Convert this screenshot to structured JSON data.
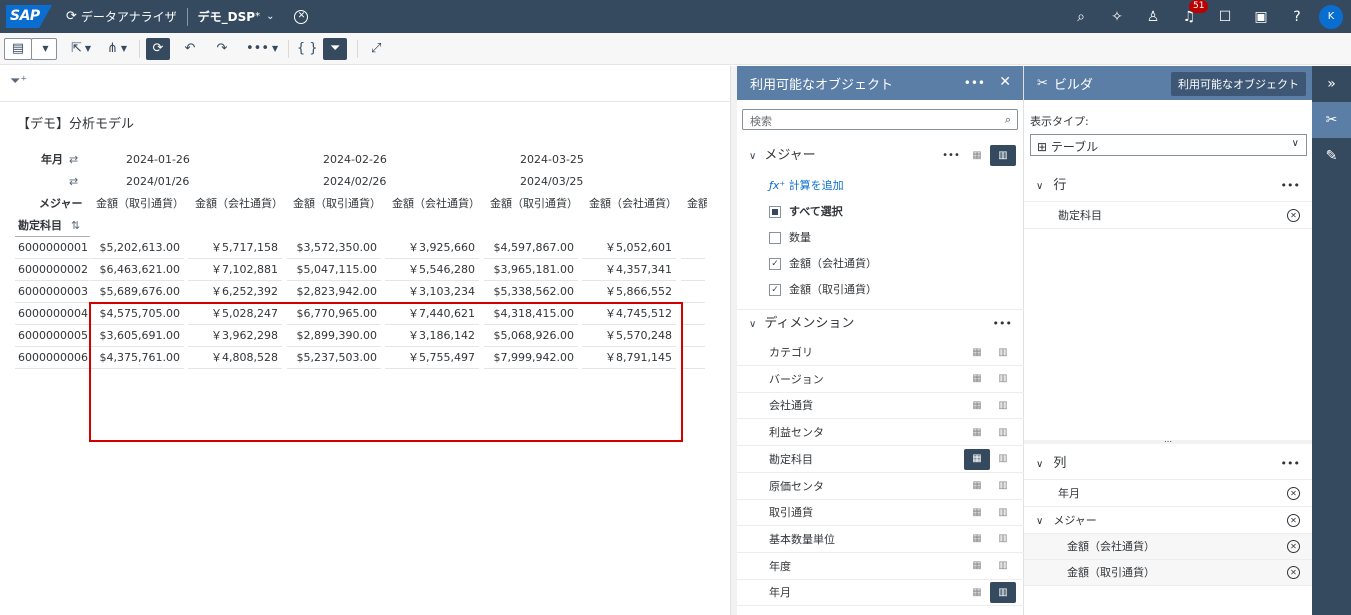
{
  "shell": {
    "logo": "SAP",
    "app_name": "データアナライザ",
    "doc_name": "デモ_DSP",
    "doc_modified": "*",
    "notif_count": "51",
    "avatar_initial": "K"
  },
  "report": {
    "title": "【デモ】分析モデル"
  },
  "grid": {
    "row_label_year": "年月",
    "row_label_measure": "メジャー",
    "row_label_account": "勘定科目",
    "date_headers": [
      "2024-01-26",
      "2024-02-26",
      "2024-03-25"
    ],
    "date_headers_alt": [
      "2024/01/26",
      "2024/02/26",
      "2024/03/25"
    ],
    "measure_headers": [
      "金額（取引通貨）",
      "金額（会社通貨）",
      "金額（取引通貨）",
      "金額（会社通貨）",
      "金額（取引通貨）",
      "金額（会社通貨）",
      "金額"
    ],
    "rows": [
      {
        "account": "6000000001",
        "values": [
          "$5,202,613.00",
          "￥5,717,158",
          "$3,572,350.00",
          "￥3,925,660",
          "$4,597,867.00",
          "￥5,052,601"
        ]
      },
      {
        "account": "6000000002",
        "values": [
          "$6,463,621.00",
          "￥7,102,881",
          "$5,047,115.00",
          "￥5,546,280",
          "$3,965,181.00",
          "￥4,357,341"
        ]
      },
      {
        "account": "6000000003",
        "values": [
          "$5,689,676.00",
          "￥6,252,392",
          "$2,823,942.00",
          "￥3,103,234",
          "$5,338,562.00",
          "￥5,866,552"
        ]
      },
      {
        "account": "6000000004",
        "values": [
          "$4,575,705.00",
          "￥5,028,247",
          "$6,770,965.00",
          "￥7,440,621",
          "$4,318,415.00",
          "￥4,745,512"
        ]
      },
      {
        "account": "6000000005",
        "values": [
          "$3,605,691.00",
          "￥3,962,298",
          "$2,899,390.00",
          "￥3,186,142",
          "$5,068,926.00",
          "￥5,570,248"
        ]
      },
      {
        "account": "6000000006",
        "values": [
          "$4,375,761.00",
          "￥4,808,528",
          "$5,237,503.00",
          "￥5,755,497",
          "$7,999,942.00",
          "￥8,791,145"
        ]
      }
    ]
  },
  "objects": {
    "title": "利用可能なオブジェクト",
    "search_placeholder": "検索",
    "measures_label": "メジャー",
    "add_calc": "計算を追加",
    "measure_items": [
      {
        "label": "すべて選択",
        "state": "partial"
      },
      {
        "label": "数量",
        "state": "off"
      },
      {
        "label": "金額（会社通貨）",
        "state": "on"
      },
      {
        "label": "金額（取引通貨）",
        "state": "on"
      }
    ],
    "dimensions_label": "ディメンション",
    "dimension_items": [
      "カテゴリ",
      "バージョン",
      "会社通貨",
      "利益センタ",
      "勘定科目",
      "原価センタ",
      "取引通貨",
      "基本数量単位",
      "年度",
      "年月"
    ]
  },
  "builder": {
    "title": "ビルダ",
    "objects_button": "利用可能なオブジェクト",
    "display_type_label": "表示タイプ:",
    "display_type_value": "テーブル",
    "rows_label": "行",
    "rows_items": [
      "勘定科目"
    ],
    "cols_label": "列",
    "cols_items": [
      "年月"
    ],
    "cols_measures_label": "メジャー",
    "cols_measure_items": [
      "金額（会社通貨）",
      "金額（取引通貨）"
    ]
  },
  "colors": {
    "shell": "#354a5f",
    "panel_header": "#5b7ea7",
    "highlight": "#d40000",
    "accent": "#0a6ed1"
  }
}
